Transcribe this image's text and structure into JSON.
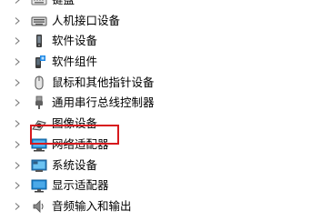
{
  "device_tree": {
    "items": [
      {
        "label": "键盘",
        "icon": "keyboard-icon"
      },
      {
        "label": "人机接口设备",
        "icon": "hid-icon"
      },
      {
        "label": "软件设备",
        "icon": "software-device-icon"
      },
      {
        "label": "软件组件",
        "icon": "software-component-icon"
      },
      {
        "label": "鼠标和其他指针设备",
        "icon": "mouse-icon"
      },
      {
        "label": "通用串行总线控制器",
        "icon": "usb-icon"
      },
      {
        "label": "图像设备",
        "icon": "camera-icon"
      },
      {
        "label": "网络适配器",
        "icon": "network-adapter-icon"
      },
      {
        "label": "系统设备",
        "icon": "system-device-icon"
      },
      {
        "label": "显示适配器",
        "icon": "display-adapter-icon"
      },
      {
        "label": "音频输入和输出",
        "icon": "audio-icon"
      }
    ]
  },
  "highlight": {
    "target": "网络适配器",
    "color": "#d7191d"
  }
}
